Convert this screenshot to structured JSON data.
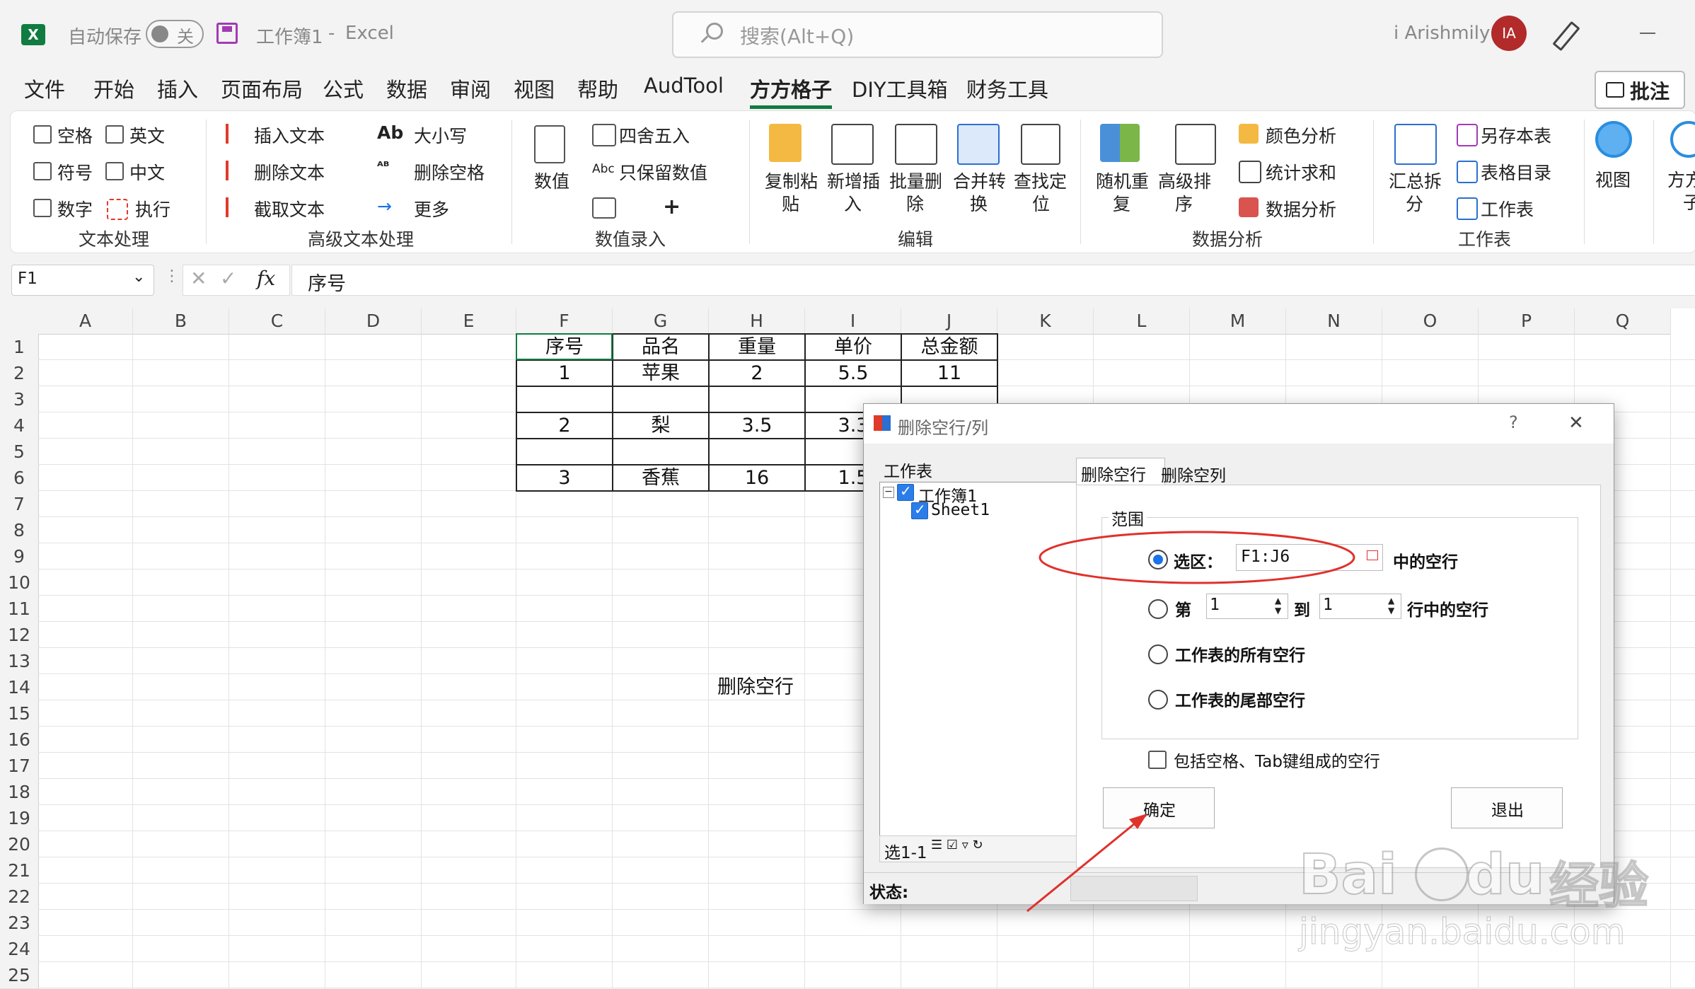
{
  "titlebar": {
    "autosave_label": "自动保存",
    "autosave_state": "关",
    "doc_title": "工作簿1",
    "app_sep": "-",
    "app_name": "Excel",
    "search_placeholder": "搜索(Alt+Q)",
    "user_name": "i Arishmily",
    "avatar_initials": "IA"
  },
  "menu": {
    "tabs": [
      "文件",
      "开始",
      "插入",
      "页面布局",
      "公式",
      "数据",
      "审阅",
      "视图",
      "帮助",
      "AudTool",
      "方方格子",
      "DIY工具箱",
      "财务工具"
    ],
    "active_tab": "方方格子",
    "notes_button": "批注"
  },
  "ribbon": {
    "text_process": {
      "items": [
        "空格",
        "英文",
        "符号",
        "中文",
        "数字",
        "执行"
      ],
      "group": "文本处理"
    },
    "adv_text": {
      "items": [
        "插入文本",
        "删除文本",
        "截取文本",
        "大小写",
        "删除空格",
        "更多"
      ],
      "group": "高级文本处理"
    },
    "number_entry": {
      "big": "数值",
      "items": [
        "四舍五入",
        "只保留数值"
      ],
      "group": "数值录入"
    },
    "edit": {
      "buttons": [
        "复制粘贴",
        "新增插入",
        "批量删除",
        "合并转换",
        "查找定位"
      ],
      "lines": [
        [
          "复制粘",
          "贴"
        ],
        [
          "新增插",
          "入"
        ],
        [
          "批量删",
          "除"
        ],
        [
          "合并转",
          "换"
        ],
        [
          "查找定",
          "位"
        ]
      ],
      "group": "编辑"
    },
    "analysis": {
      "buttons": [
        [
          "随机重",
          "复"
        ],
        [
          "高级排",
          "序"
        ]
      ],
      "items": [
        "颜色分析",
        "统计求和",
        "数据分析"
      ],
      "group": "数据分析"
    },
    "sheet": {
      "big": [
        "汇总拆",
        "分"
      ],
      "items": [
        "另存本表",
        "表格目录",
        "工作表"
      ],
      "group": "工作表"
    },
    "view": {
      "label": "视图",
      "cut": [
        "方方",
        "子"
      ]
    }
  },
  "formula_bar": {
    "name_box": "F1",
    "fx": "fx",
    "content": "序号"
  },
  "sheet": {
    "columns": [
      "A",
      "B",
      "C",
      "D",
      "E",
      "F",
      "G",
      "H",
      "I",
      "J",
      "K",
      "L",
      "M",
      "N",
      "O",
      "P",
      "Q"
    ],
    "rows": [
      "1",
      "2",
      "3",
      "4",
      "5",
      "6",
      "7",
      "8",
      "9",
      "10",
      "11",
      "12",
      "13",
      "14",
      "15",
      "16",
      "17",
      "18",
      "19",
      "20",
      "21",
      "22",
      "23",
      "24",
      "25"
    ],
    "table": {
      "header": [
        "序号",
        "品名",
        "重量",
        "单价",
        "总金额"
      ],
      "rows": [
        [
          "1",
          "苹果",
          "2",
          "5.5",
          "11"
        ],
        [
          "",
          "",
          "",
          "",
          ""
        ],
        [
          "2",
          "梨",
          "3.5",
          "3.3",
          ""
        ],
        [
          "",
          "",
          "",
          "",
          ""
        ],
        [
          "3",
          "香蕉",
          "16",
          "1.5",
          ""
        ]
      ]
    },
    "note_cell": "删除空行"
  },
  "dialog": {
    "title": "删除空行/列",
    "help": "?",
    "close": "✕",
    "worksheet_label": "工作表",
    "tree": {
      "workbook": "工作簿1",
      "sheet": "Sheet1"
    },
    "tree_footer": "选1-1",
    "tabs": [
      "删除空行",
      "删除空列"
    ],
    "range_label": "范围",
    "opt_selection": "选区：",
    "selection_value": "F1:J6",
    "selection_suffix": "中的空行",
    "opt_rows_prefix": "第",
    "row_from": "1",
    "opt_rows_to": "到",
    "row_to": "1",
    "opt_rows_suffix": "行中的空行",
    "opt_all": "工作表的所有空行",
    "opt_tail": "工作表的尾部空行",
    "include_blank": "包括空格、Tab键组成的空行",
    "ok": "确定",
    "exit": "退出",
    "status_label": "状态:"
  },
  "watermark": {
    "brand": "Bai",
    "brand2": "du",
    "cn": "经验",
    "url": "jingyan.baidu.com"
  },
  "colors": {
    "excel_green": "#107c41",
    "annotation_red": "#e0312b",
    "dialog_bg": "#f0f0f0",
    "radio_blue": "#1a73e8"
  }
}
